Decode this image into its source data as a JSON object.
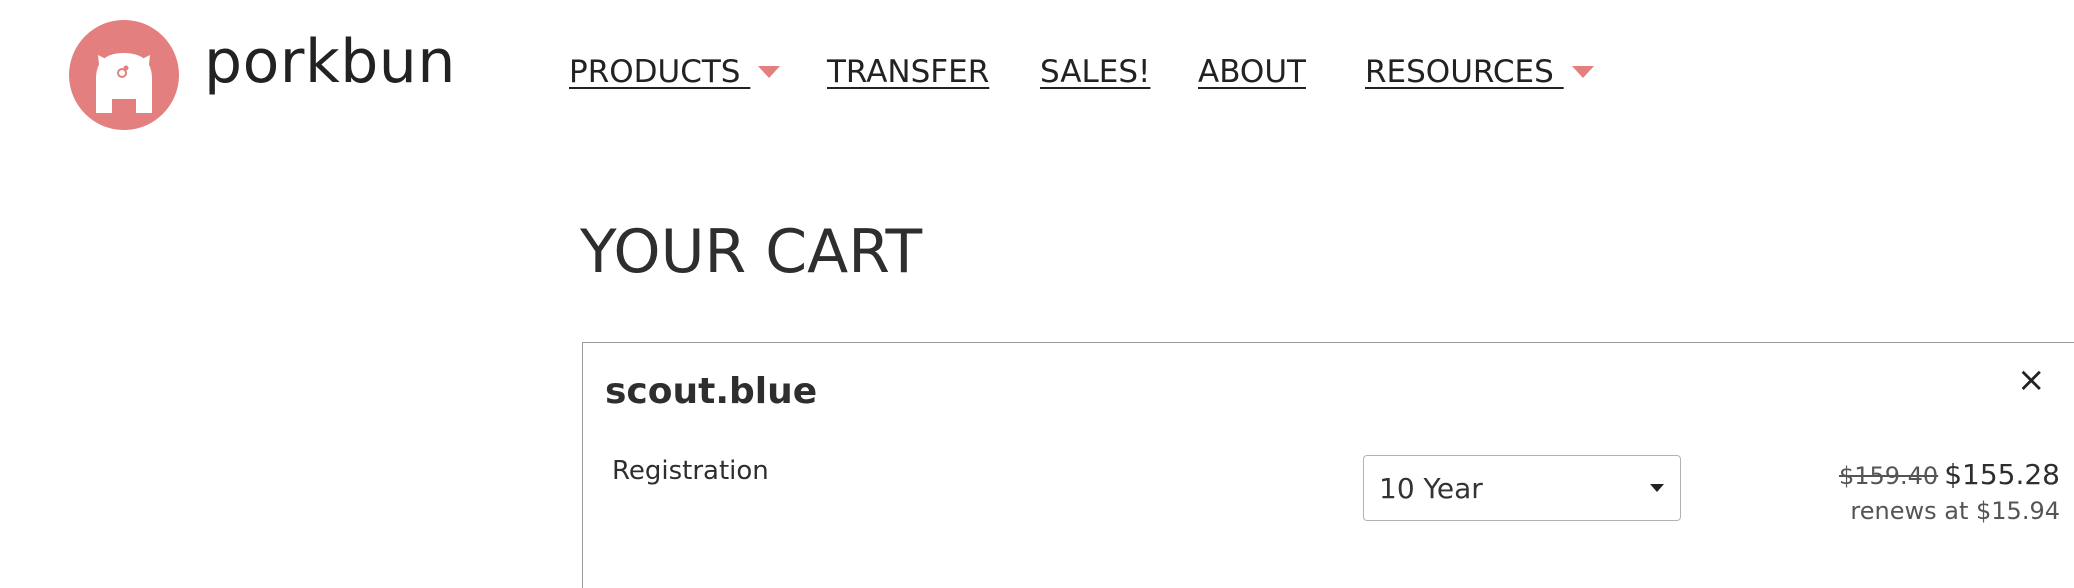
{
  "header": {
    "brand": "porkbun",
    "nav": [
      {
        "label": "PRODUCTS ",
        "has_dropdown": true
      },
      {
        "label": "TRANSFER",
        "has_dropdown": false
      },
      {
        "label": "SALES!",
        "has_dropdown": false
      },
      {
        "label": "ABOUT",
        "has_dropdown": false
      },
      {
        "label": "RESOURCES ",
        "has_dropdown": true
      }
    ],
    "logo_icon": "pig-logo-icon",
    "accent_color": "#e47f7f"
  },
  "cart": {
    "title": "YOUR CART",
    "items": [
      {
        "domain": "scout.blue",
        "remove_icon": "close-icon",
        "remove_label": "×",
        "line_label": "Registration",
        "term_selected": "10 Year",
        "original_price": "$159.40",
        "price": "$155.28",
        "renewal_text": "renews at $15.94"
      }
    ]
  }
}
